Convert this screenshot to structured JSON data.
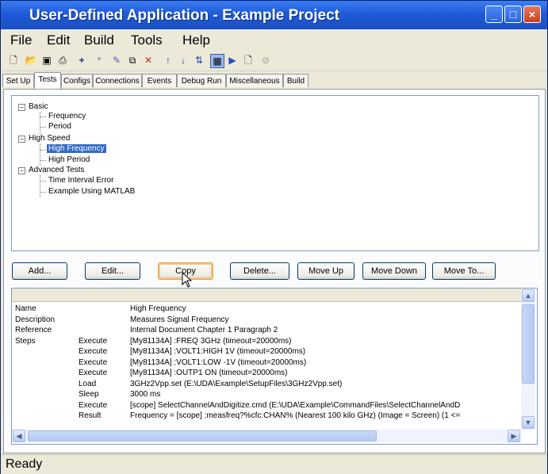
{
  "window": {
    "title": "User-Defined Application - Example Project"
  },
  "menu": [
    "File",
    "Edit",
    "Build",
    "Tools",
    "Help"
  ],
  "toolbar": {
    "icons": [
      "new-icon",
      "open-icon",
      "save-icon",
      "print-icon",
      "add-icon",
      "add-child-icon",
      "edit-icon",
      "copy-icon",
      "delete-icon",
      "move-up-icon",
      "move-down-icon",
      "move-to-icon",
      "run-icon",
      "play-icon",
      "page-icon",
      "stop-icon"
    ]
  },
  "tabs": [
    "Set Up",
    "Tests",
    "Configs",
    "Connections",
    "Events",
    "Debug Run",
    "Miscellaneous",
    "Build"
  ],
  "active_tab": "Tests",
  "tree": {
    "groups": [
      {
        "label": "Basic",
        "items": [
          "Frequency",
          "Period"
        ]
      },
      {
        "label": "High Speed",
        "items": [
          "High Frequency",
          "High Period"
        ]
      },
      {
        "label": "Advanced Tests",
        "items": [
          "Time Interval Error",
          "Example Using MATLAB"
        ]
      }
    ],
    "selected": "High Frequency"
  },
  "buttons": [
    "Add...",
    "Edit...",
    "Copy",
    "Delete...",
    "Move Up",
    "Move Down",
    "Move To..."
  ],
  "details": [
    [
      "Name",
      "",
      "High Frequency"
    ],
    [
      "Description",
      "",
      "Measures Signal Frequency"
    ],
    [
      "Reference",
      "",
      "Internal Document Chapter 1 Paragraph 2"
    ],
    [
      "Steps",
      "Execute",
      "[My81134A] :FREQ 3GHz (timeout=20000ms)"
    ],
    [
      "",
      "Execute",
      "[My81134A] :VOLT1:HIGH 1V (timeout=20000ms)"
    ],
    [
      "",
      "Execute",
      "[My81134A] :VOLT1:LOW -1V (timeout=20000ms)"
    ],
    [
      "",
      "Execute",
      "[My81134A] :OUTP1 ON (timeout=20000ms)"
    ],
    [
      "",
      "Load",
      "3GHz2Vpp.set (E:\\UDA\\Example\\SetupFiles\\3GHz2Vpp.set)"
    ],
    [
      "",
      "Sleep",
      "3000 ms"
    ],
    [
      "",
      "Execute",
      "[scope] SelectChannelAndDigitize.cmd (E:\\UDA\\Example\\CommandFiles\\SelectChannelAndD"
    ],
    [
      "",
      "Result",
      "Frequency = [scope] :measfreq?%cfc:CHAN%  (Nearest 100 kilo GHz) (Image = Screen) (1 <="
    ]
  ],
  "status": "Ready"
}
